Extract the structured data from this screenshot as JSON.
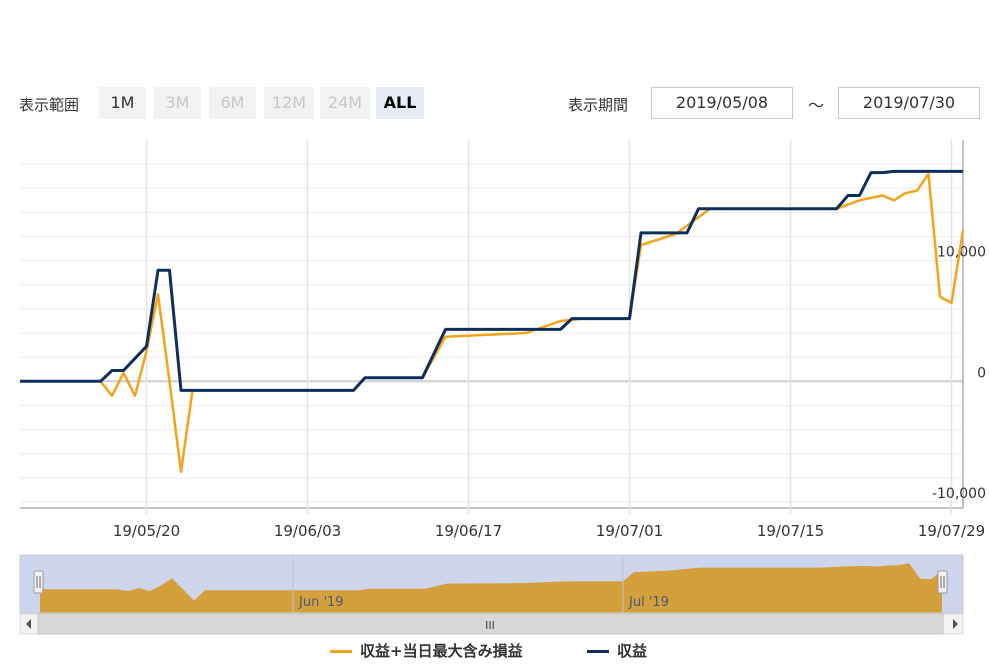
{
  "toolbar": {
    "range_label": "表示範囲",
    "range_buttons": [
      {
        "label": "1M",
        "state": "enabled"
      },
      {
        "label": "3M",
        "state": "disabled"
      },
      {
        "label": "6M",
        "state": "disabled"
      },
      {
        "label": "12M",
        "state": "disabled"
      },
      {
        "label": "24M",
        "state": "disabled"
      },
      {
        "label": "ALL",
        "state": "active"
      }
    ],
    "period_label": "表示期間",
    "date_from": "2019/05/08",
    "tilde": "～",
    "date_to": "2019/07/30"
  },
  "navigator": {
    "month_labels": [
      "Jun '19",
      "Jul '19"
    ],
    "scroll_handle": "III"
  },
  "colors": {
    "series_orange": "#f5a31a",
    "series_navy": "#0d2f5a",
    "navigator_fill": "#d4a03c",
    "navigator_mask": "#cdd6ec",
    "grid": "#e6e6e6"
  },
  "chart_data": {
    "type": "line",
    "x_start": "2019-05-09",
    "x_end": "2019-07-30",
    "xticks": [
      "19/05/20",
      "19/06/03",
      "19/06/17",
      "19/07/01",
      "19/07/15",
      "19/07/29"
    ],
    "xtick_dates": [
      "2019-05-20",
      "2019-06-03",
      "2019-06-17",
      "2019-07-01",
      "2019-07-15",
      "2019-07-29"
    ],
    "yticks": [
      "10,000",
      "0",
      "-10,000"
    ],
    "ytick_values": [
      10000,
      0,
      -10000
    ],
    "ylim": [
      -10500,
      20000
    ],
    "series": [
      {
        "name": "収益+当日最大含み損益",
        "color": "#f5a31a",
        "points": [
          [
            "2019-05-09",
            0
          ],
          [
            "2019-05-16",
            0
          ],
          [
            "2019-05-17",
            -1200
          ],
          [
            "2019-05-18",
            700
          ],
          [
            "2019-05-19",
            -1200
          ],
          [
            "2019-05-20",
            2500
          ],
          [
            "2019-05-21",
            7200
          ],
          [
            "2019-05-22",
            0
          ],
          [
            "2019-05-23",
            -7500
          ],
          [
            "2019-05-24",
            -750
          ],
          [
            "2019-06-07",
            -750
          ],
          [
            "2019-06-08",
            300
          ],
          [
            "2019-06-13",
            300
          ],
          [
            "2019-06-15",
            3700
          ],
          [
            "2019-06-22",
            4000
          ],
          [
            "2019-06-25",
            5000
          ],
          [
            "2019-06-27",
            5200
          ],
          [
            "2019-07-01",
            5200
          ],
          [
            "2019-07-02",
            11300
          ],
          [
            "2019-07-05",
            12200
          ],
          [
            "2019-07-08",
            14300
          ],
          [
            "2019-07-15",
            14300
          ],
          [
            "2019-07-19",
            14300
          ],
          [
            "2019-07-21",
            15000
          ],
          [
            "2019-07-23",
            15400
          ],
          [
            "2019-07-24",
            15000
          ],
          [
            "2019-07-25",
            15600
          ],
          [
            "2019-07-26",
            15800
          ],
          [
            "2019-07-27",
            17200
          ],
          [
            "2019-07-28",
            7000
          ],
          [
            "2019-07-29",
            6500
          ],
          [
            "2019-07-30",
            12500
          ]
        ]
      },
      {
        "name": "収益",
        "color": "#0d2f5a",
        "points": [
          [
            "2019-05-09",
            0
          ],
          [
            "2019-05-16",
            0
          ],
          [
            "2019-05-17",
            900
          ],
          [
            "2019-05-18",
            900
          ],
          [
            "2019-05-20",
            2900
          ],
          [
            "2019-05-21",
            9200
          ],
          [
            "2019-05-22",
            9200
          ],
          [
            "2019-05-23",
            -750
          ],
          [
            "2019-06-07",
            -750
          ],
          [
            "2019-06-08",
            300
          ],
          [
            "2019-06-13",
            300
          ],
          [
            "2019-06-15",
            4300
          ],
          [
            "2019-06-25",
            4300
          ],
          [
            "2019-06-26",
            5200
          ],
          [
            "2019-07-01",
            5200
          ],
          [
            "2019-07-02",
            12300
          ],
          [
            "2019-07-06",
            12300
          ],
          [
            "2019-07-07",
            14300
          ],
          [
            "2019-07-19",
            14300
          ],
          [
            "2019-07-20",
            15400
          ],
          [
            "2019-07-21",
            15400
          ],
          [
            "2019-07-22",
            17300
          ],
          [
            "2019-07-23",
            17300
          ],
          [
            "2019-07-24",
            17400
          ],
          [
            "2019-07-30",
            17400
          ]
        ]
      }
    ]
  }
}
